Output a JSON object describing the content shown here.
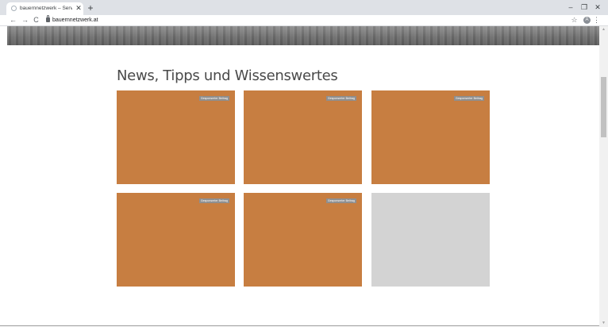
{
  "browser": {
    "tab": {
      "title": "bauernnetzwerk – Serviceplattfo…",
      "close_glyph": "✕",
      "favicon": "site-favicon"
    },
    "new_tab_glyph": "+",
    "window_controls": {
      "minimize": "–",
      "maximize": "❐",
      "close": "✕"
    },
    "nav": {
      "back": "←",
      "forward": "→",
      "reload": "C"
    },
    "url": "bauernnetzwerk.at",
    "bookmark_glyph": "☆",
    "profile_initial": "A",
    "menu_glyph": "⋮"
  },
  "page": {
    "section_heading": "News, Tipps und Wissenswertes",
    "cards": [
      {
        "badge": "Gesponserter Beitrag",
        "color": "#c77e41"
      },
      {
        "badge": "Gesponserter Beitrag",
        "color": "#c77e41"
      },
      {
        "badge": "Gesponserter Beitrag",
        "color": "#c77e41"
      },
      {
        "badge": "Gesponserter Beitrag",
        "color": "#c77e41"
      },
      {
        "badge": "Gesponserter Beitrag",
        "color": "#c77e41"
      },
      {
        "badge": "",
        "color": "#d3d3d3"
      }
    ]
  },
  "scrollbar": {
    "up_glyph": "▲",
    "down_glyph": "▼"
  },
  "colors": {
    "accent_card": "#c77e41",
    "placeholder_card": "#d3d3d3",
    "heading": "#4a4a4a"
  }
}
